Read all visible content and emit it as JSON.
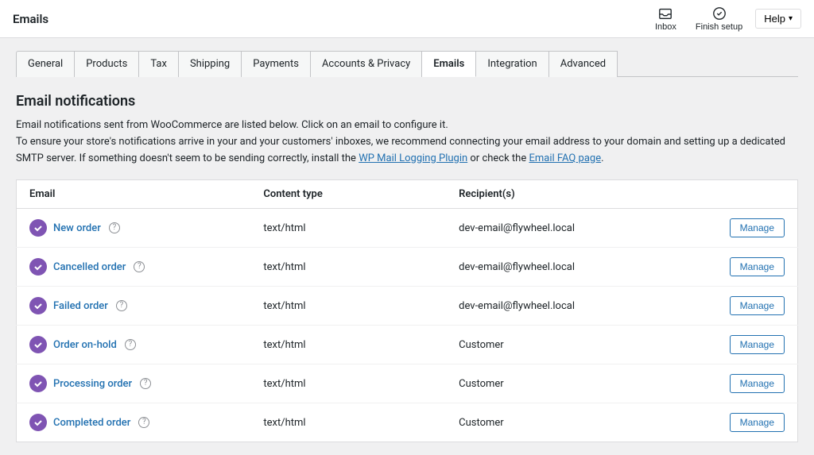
{
  "topbar": {
    "title": "Emails",
    "inbox_label": "Inbox",
    "finish_setup_label": "Finish setup",
    "help_label": "Help"
  },
  "tabs": [
    {
      "label": "General",
      "active": false
    },
    {
      "label": "Products",
      "active": false
    },
    {
      "label": "Tax",
      "active": false
    },
    {
      "label": "Shipping",
      "active": false
    },
    {
      "label": "Payments",
      "active": false
    },
    {
      "label": "Accounts & Privacy",
      "active": false
    },
    {
      "label": "Emails",
      "active": true
    },
    {
      "label": "Integration",
      "active": false
    },
    {
      "label": "Advanced",
      "active": false
    }
  ],
  "section": {
    "title": "Email notifications",
    "description_part1": "Email notifications sent from WooCommerce are listed below. Click on an email to configure it.",
    "description_part2": "To ensure your store's notifications arrive in your and your customers' inboxes, we recommend connecting your email address to your domain and setting up a dedicated SMTP server. If something doesn't seem to be sending correctly, install the ",
    "link1_text": "WP Mail Logging Plugin",
    "description_part3": " or check the ",
    "link2_text": "Email FAQ page",
    "description_part4": "."
  },
  "table": {
    "headers": {
      "email": "Email",
      "content_type": "Content type",
      "recipients": "Recipient(s)",
      "action": ""
    },
    "rows": [
      {
        "name": "New order",
        "content_type": "text/html",
        "recipient": "dev-email@flywheel.local",
        "enabled": true,
        "action_label": "Manage"
      },
      {
        "name": "Cancelled order",
        "content_type": "text/html",
        "recipient": "dev-email@flywheel.local",
        "enabled": true,
        "action_label": "Manage"
      },
      {
        "name": "Failed order",
        "content_type": "text/html",
        "recipient": "dev-email@flywheel.local",
        "enabled": true,
        "action_label": "Manage"
      },
      {
        "name": "Order on-hold",
        "content_type": "text/html",
        "recipient": "Customer",
        "enabled": true,
        "action_label": "Manage"
      },
      {
        "name": "Processing order",
        "content_type": "text/html",
        "recipient": "Customer",
        "enabled": true,
        "action_label": "Manage"
      },
      {
        "name": "Completed order",
        "content_type": "text/html",
        "recipient": "Customer",
        "enabled": true,
        "action_label": "Manage"
      }
    ]
  }
}
